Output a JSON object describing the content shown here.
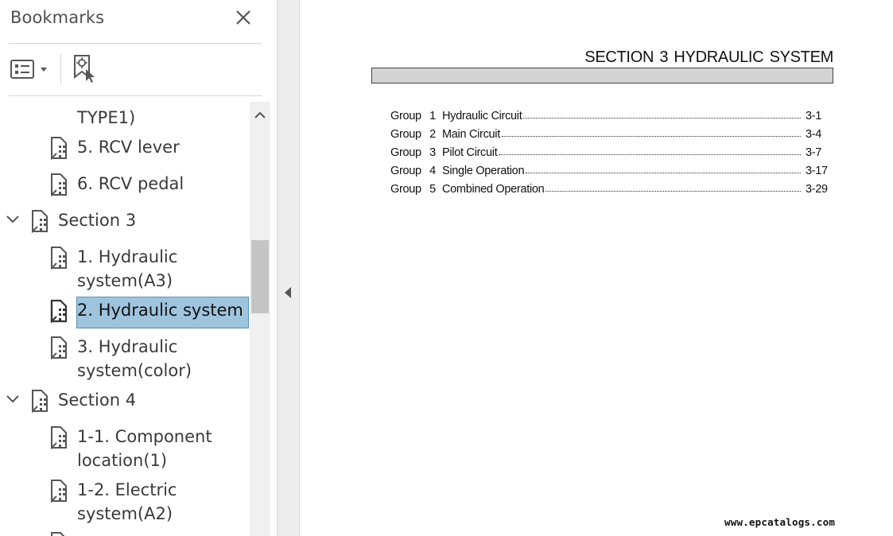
{
  "panel": {
    "title": "Bookmarks",
    "icons": {
      "close": "close-icon",
      "options": "options-menu-icon",
      "new_bookmark": "new-bookmark-icon",
      "bookmark": "bookmark-icon"
    },
    "items": [
      {
        "text": "TYPE1)",
        "level": 2,
        "icon": false,
        "chevron": false,
        "selected": false
      },
      {
        "text": "5. RCV lever",
        "level": 2,
        "icon": true,
        "chevron": false,
        "selected": false
      },
      {
        "text": "6. RCV pedal",
        "level": 2,
        "icon": true,
        "chevron": false,
        "selected": false
      },
      {
        "text": "Section 3",
        "level": 1,
        "icon": true,
        "chevron": true,
        "selected": false
      },
      {
        "text": "1. Hydraulic",
        "level": 2,
        "icon": true,
        "chevron": false,
        "selected": false
      },
      {
        "text": "system(A3)",
        "level": 2,
        "icon": false,
        "chevron": false,
        "selected": false
      },
      {
        "text": "2. Hydraulic system",
        "level": 2,
        "icon": true,
        "chevron": false,
        "selected": true
      },
      {
        "text": "3. Hydraulic",
        "level": 2,
        "icon": true,
        "chevron": false,
        "selected": false
      },
      {
        "text": "system(color)",
        "level": 2,
        "icon": false,
        "chevron": false,
        "selected": false
      },
      {
        "text": "Section 4",
        "level": 1,
        "icon": true,
        "chevron": true,
        "selected": false
      },
      {
        "text": "1-1. Component",
        "level": 2,
        "icon": true,
        "chevron": false,
        "selected": false
      },
      {
        "text": "location(1)",
        "level": 2,
        "icon": false,
        "chevron": false,
        "selected": false
      },
      {
        "text": "1-2. Electric",
        "level": 2,
        "icon": true,
        "chevron": false,
        "selected": false
      },
      {
        "text": "system(A2)",
        "level": 2,
        "icon": false,
        "chevron": false,
        "selected": false
      }
    ],
    "colors": {
      "selected_bg": "#9fc4dd",
      "selected_border": "#5a8fb5"
    }
  },
  "document": {
    "section_title": "SECTION  3  HYDRAULIC SYSTEM",
    "toc": [
      {
        "group": "Group",
        "num": "1",
        "name": "Hydraulic Circuit",
        "page": "3-1"
      },
      {
        "group": "Group",
        "num": "2",
        "name": "Main Circuit",
        "page": "3-4"
      },
      {
        "group": "Group",
        "num": "3",
        "name": "Pilot Circuit",
        "page": "3-7"
      },
      {
        "group": "Group",
        "num": "4",
        "name": "Single Operation",
        "page": "3-17"
      },
      {
        "group": "Group",
        "num": "5",
        "name": "Combined Operation",
        "page": "3-29"
      }
    ],
    "watermark": "www.epcatalogs.com"
  }
}
